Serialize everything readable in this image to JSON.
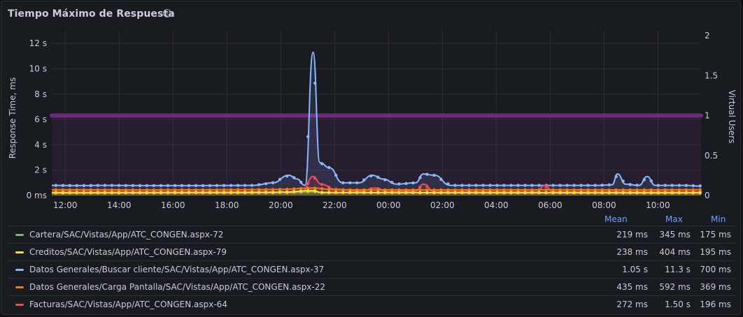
{
  "panel": {
    "title": "Tiempo Máximo de Respuesta",
    "info_icon": "info-circle-icon"
  },
  "legend": {
    "headers": {
      "mean": "Mean",
      "max": "Max",
      "min": "Min"
    },
    "rows": [
      {
        "name": "Cartera/SAC/Vistas/App/ATC_CONGEN.aspx-72",
        "color": "#73bf69",
        "mean": "219 ms",
        "max": "345 ms",
        "min": "175 ms"
      },
      {
        "name": "Creditos/SAC/Vistas/App/ATC_CONGEN.aspx-79",
        "color": "#fade2a",
        "mean": "238 ms",
        "max": "404 ms",
        "min": "195 ms"
      },
      {
        "name": "Datos Generales/Buscar cliente/SAC/Vistas/App/ATC_CONGEN.aspx-37",
        "color": "#8ab8ff",
        "mean": "1.05 s",
        "max": "11.3 s",
        "min": "700 ms"
      },
      {
        "name": "Datos Generales/Carga Pantalla/SAC/Vistas/App/ATC_CONGEN.aspx-22",
        "color": "#ff780a",
        "mean": "435 ms",
        "max": "592 ms",
        "min": "369 ms"
      },
      {
        "name": "Facturas/SAC/Vistas/App/ATC_CONGEN.aspx-64",
        "color": "#f2495c",
        "mean": "272 ms",
        "max": "1.50 s",
        "min": "196 ms"
      }
    ]
  },
  "chart_data": {
    "type": "line",
    "ylabel": "Response Time, ms",
    "y2label": "Virtual Users",
    "yticks": [
      "0 ms",
      "2 s",
      "4 s",
      "6 s",
      "8 s",
      "10 s",
      "12 s"
    ],
    "y2ticks": [
      "0",
      "0.5",
      "1",
      "1.5",
      "2"
    ],
    "xticks": [
      "12:00",
      "14:00",
      "16:00",
      "18:00",
      "20:00",
      "22:00",
      "00:00",
      "02:00",
      "04:00",
      "06:00",
      "08:00",
      "10:00"
    ],
    "ylim": [
      0,
      13
    ],
    "y2lim": [
      0,
      2
    ],
    "x_start_hour": 11.5,
    "x_end_hour": 35.6,
    "grid": true,
    "virtual_users": {
      "name": "Virtual Users",
      "color": "#6c2b7a",
      "value": 1
    },
    "series": [
      {
        "ref": 2,
        "color": "#8ab8ff",
        "points": [
          [
            11.5,
            0.8
          ],
          [
            12.5,
            0.78
          ],
          [
            13.5,
            0.8
          ],
          [
            15,
            0.78
          ],
          [
            17,
            0.78
          ],
          [
            19,
            0.8
          ],
          [
            19.7,
            1.0
          ],
          [
            20.3,
            1.6
          ],
          [
            20.6,
            1.3
          ],
          [
            20.9,
            0.8
          ],
          [
            21.2,
            11.3
          ],
          [
            21.45,
            2.6
          ],
          [
            21.8,
            2.2
          ],
          [
            22.3,
            1.0
          ],
          [
            22.9,
            1.0
          ],
          [
            23.4,
            1.6
          ],
          [
            23.8,
            1.3
          ],
          [
            24.3,
            0.9
          ],
          [
            25,
            1.0
          ],
          [
            25.3,
            1.7
          ],
          [
            25.7,
            1.6
          ],
          [
            26.3,
            0.8
          ],
          [
            27,
            0.8
          ],
          [
            28,
            0.8
          ],
          [
            29.2,
            0.8
          ],
          [
            30.5,
            0.8
          ],
          [
            31.8,
            0.8
          ],
          [
            32.3,
            0.85
          ],
          [
            32.5,
            1.7
          ],
          [
            32.8,
            0.9
          ],
          [
            33.3,
            0.8
          ],
          [
            33.6,
            1.5
          ],
          [
            33.9,
            0.8
          ],
          [
            35,
            0.8
          ],
          [
            35.6,
            0.75
          ]
        ]
      },
      {
        "ref": 4,
        "color": "#f2495c",
        "points": [
          [
            11.5,
            0.3
          ],
          [
            16,
            0.28
          ],
          [
            20,
            0.3
          ],
          [
            20.8,
            0.35
          ],
          [
            21.2,
            1.5
          ],
          [
            21.5,
            0.9
          ],
          [
            22,
            0.5
          ],
          [
            23,
            0.35
          ],
          [
            23.5,
            0.6
          ],
          [
            24,
            0.3
          ],
          [
            25,
            0.35
          ],
          [
            25.3,
            0.9
          ],
          [
            25.7,
            0.3
          ],
          [
            27.5,
            0.3
          ],
          [
            29.5,
            0.3
          ],
          [
            29.8,
            0.8
          ],
          [
            30.1,
            0.3
          ],
          [
            32,
            0.3
          ],
          [
            35.6,
            0.3
          ]
        ]
      },
      {
        "ref": 3,
        "color": "#ff780a",
        "points": [
          [
            11.5,
            0.45
          ],
          [
            15,
            0.44
          ],
          [
            18,
            0.45
          ],
          [
            20,
            0.48
          ],
          [
            21.2,
            0.59
          ],
          [
            22,
            0.45
          ],
          [
            26,
            0.44
          ],
          [
            30,
            0.45
          ],
          [
            33,
            0.44
          ],
          [
            35.6,
            0.45
          ]
        ]
      },
      {
        "ref": 0,
        "color": "#73bf69",
        "points": [
          [
            11.5,
            0.2
          ],
          [
            19.8,
            0.22
          ],
          [
            20.0,
            0.345
          ],
          [
            20.2,
            0.22
          ],
          [
            21.2,
            0.3
          ],
          [
            21.5,
            0.22
          ],
          [
            35.6,
            0.2
          ]
        ]
      },
      {
        "ref": 1,
        "color": "#fade2a",
        "points": [
          [
            11.5,
            0.22
          ],
          [
            16,
            0.23
          ],
          [
            20,
            0.25
          ],
          [
            21.2,
            0.404
          ],
          [
            21.5,
            0.25
          ],
          [
            26,
            0.23
          ],
          [
            30,
            0.23
          ],
          [
            35.6,
            0.22
          ]
        ]
      }
    ]
  }
}
